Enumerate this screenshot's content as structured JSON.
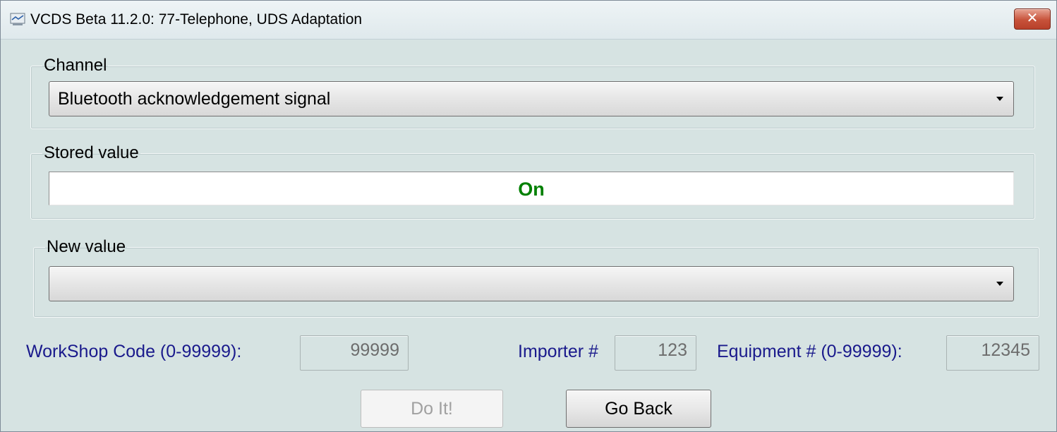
{
  "window": {
    "title": "VCDS Beta 11.2.0: 77-Telephone,  UDS Adaptation",
    "close_label": "✕"
  },
  "channel": {
    "legend": "Channel",
    "selected": "Bluetooth acknowledgement signal"
  },
  "stored": {
    "legend": "Stored value",
    "value": "On",
    "value_color": "#008000"
  },
  "new_value": {
    "legend": "New value",
    "selected": ""
  },
  "workshop": {
    "label": "WorkShop Code (0-99999):",
    "value": "99999"
  },
  "importer": {
    "label": "Importer #",
    "value": "123"
  },
  "equipment": {
    "label": "Equipment # (0-99999):",
    "value": "12345"
  },
  "buttons": {
    "do_it": "Do It!",
    "go_back": "Go Back"
  },
  "colors": {
    "window_bg": "#d6e3e2",
    "label_blue": "#1a1a8c",
    "close_red": "#c7523a"
  }
}
